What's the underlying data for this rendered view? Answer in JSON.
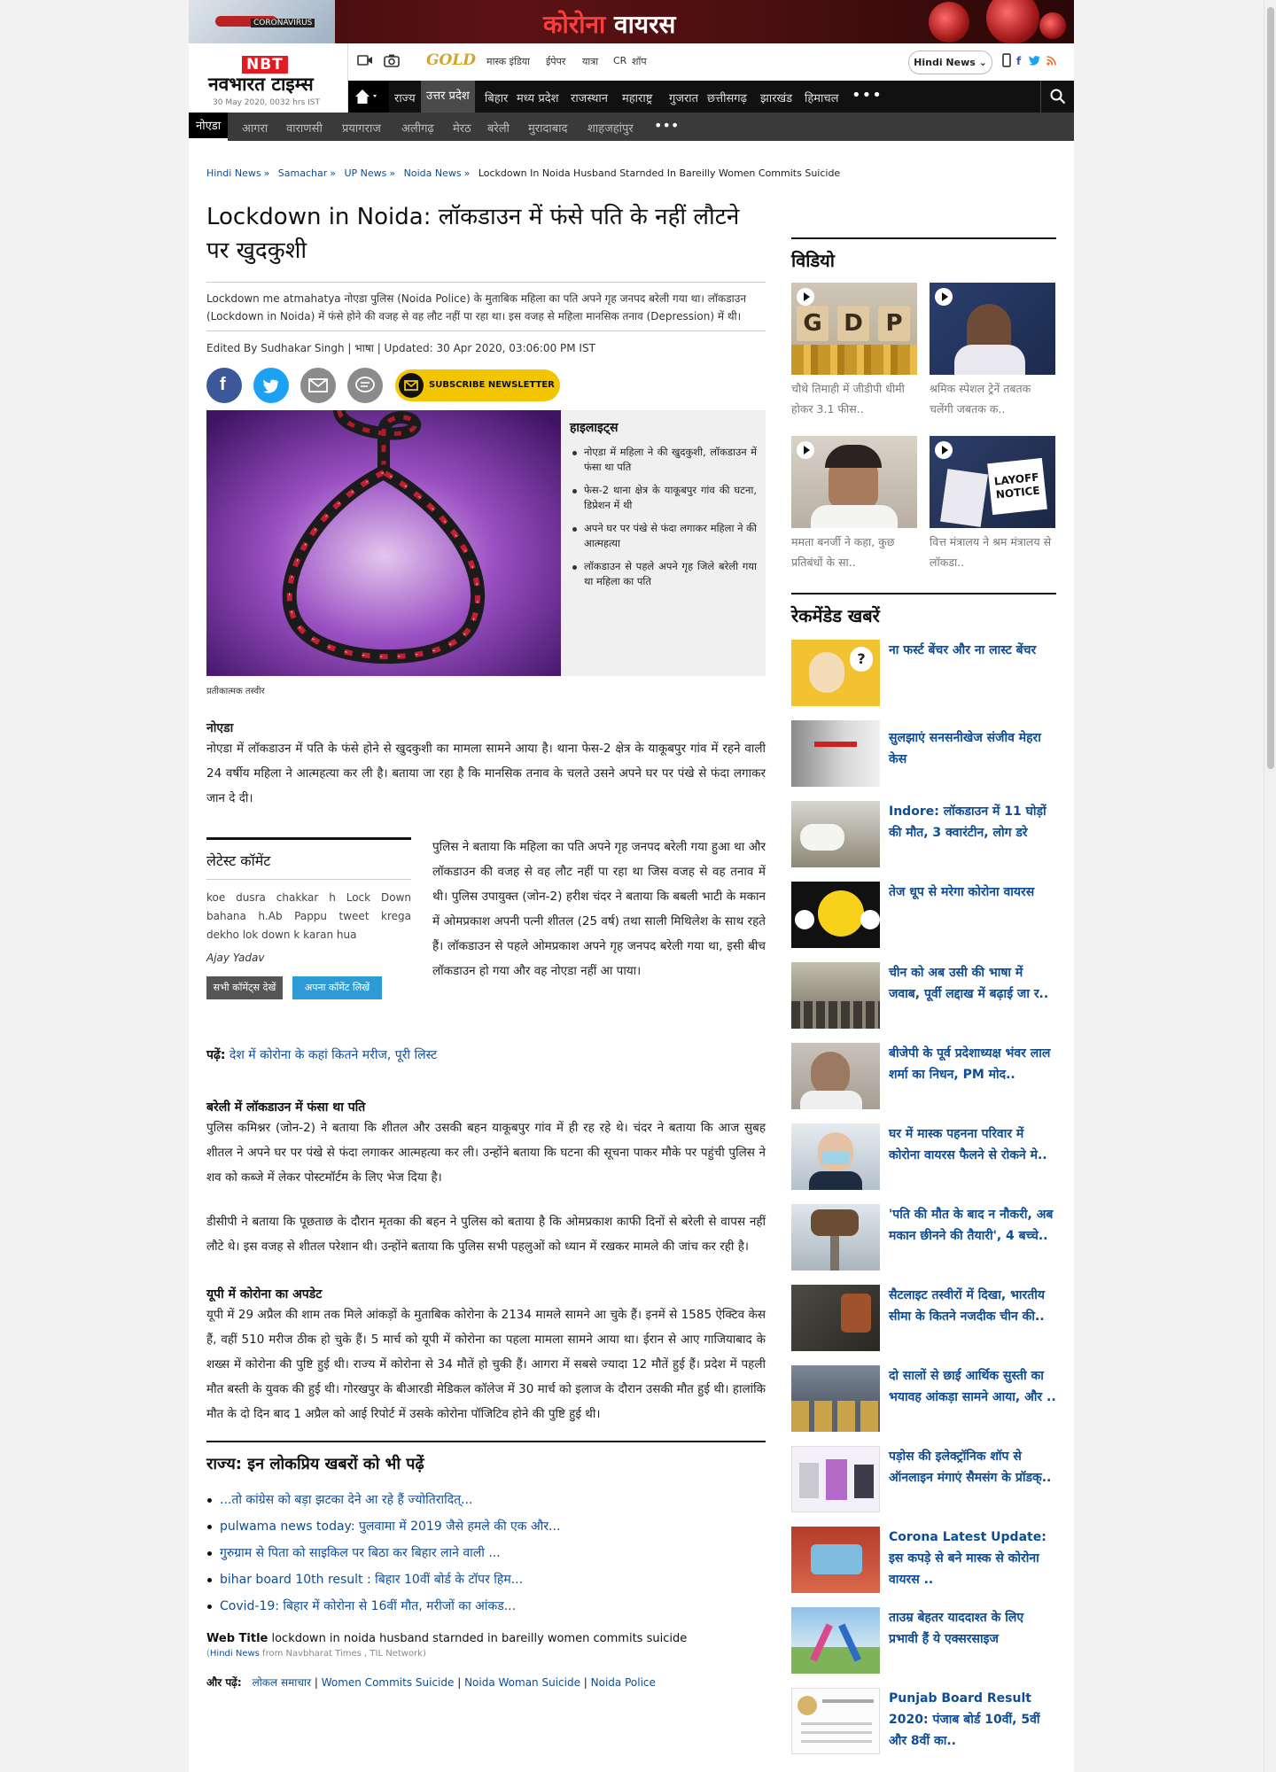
{
  "banner": {
    "title_red": "कोरोना",
    "title_white": "वायरस",
    "tag": "CORONAVIRUS"
  },
  "header": {
    "logo_abbr": "NBT",
    "logo_name": "नवभारत टाइम्स",
    "date": "30 May 2020, 0032 hrs IST",
    "gold": "GOLD",
    "top_links": [
      "मास्क इंडिया",
      "ईपेपर",
      "यात्रा",
      "CR",
      "शॉप"
    ],
    "lang_button": "Hindi News ⌄",
    "social": [
      "f",
      "t",
      "rss"
    ]
  },
  "nav": {
    "items": [
      "राज्य",
      "उत्तर प्रदेश",
      "बिहार",
      "मध्य प्रदेश",
      "राजस्थान",
      "महाराष्ट्र",
      "गुजरात",
      "छत्तीसगढ़",
      "झारखंड",
      "हिमाचल"
    ],
    "more": "•••"
  },
  "subnav": {
    "items": [
      "नोएडा",
      "आगरा",
      "वाराणसी",
      "प्रयागराज",
      "अलीगढ़",
      "मेरठ",
      "बरेली",
      "मुरादाबाद",
      "शाहजहांपुर"
    ],
    "more": "•••"
  },
  "breadcrumb": {
    "items": [
      "Hindi News",
      "Samachar",
      "UP News",
      "Noida News"
    ],
    "sep": "»",
    "current": "Lockdown In Noida Husband Starnded In Bareilly Women Commits Suicide"
  },
  "article": {
    "headline": "Lockdown in Noida: लॉकडाउन में फंसे पति के नहीं लौटने पर खुदकुशी",
    "summary": "Lockdown me atmahatya नोएडा पुलिस (Noida Police) के मुताबिक महिला का पति अपने गृह जनपद बरेली गया था। लॉकडाउन (Lockdown in Noida) में फंसे होने की वजह से वह लौट नहीं पा रहा था। इस वजह से महिला मानसिक तनाव (Depression) में थी।",
    "byline": "Edited By Sudhakar Singh | भाषा | Updated: 30 Apr 2020, 03:06:00 PM IST",
    "newsletter": "SUBSCRIBE NEWSLETTER",
    "highlights_title": "हाइलाइट्स",
    "highlights": [
      "नोएडा में महिला ने की खुदकुशी, लॉकडाउन में फंसा था पति",
      "फेस-2 थाना क्षेत्र के याकूबपुर गांव की घटना, डिप्रेशन में थी",
      "अपने घर पर पंखे से फंदा लगाकर महिला ने की आत्महत्या",
      "लॉकडाउन से पहले अपने गृह जिले बरेली गया था महिला का पति"
    ],
    "caption": "प्रतीकात्मक तस्वीर",
    "place": "नोएडा",
    "para1": "नोएडा में लॉकडाउन में पति के फंसे होने से खुदकुशी का मामला सामने आया है। थाना फेस-2 क्षेत्र के याकूबपुर गांव में रहने वाली 24 वर्षीय महिला ने आत्महत्या कर ली है। बताया जा रहा है कि मानसिक तनाव के चलते उसने अपने घर पर पंखे से फंदा लगाकर जान दे दी।",
    "para2": "पुलिस ने बताया कि महिला का पति अपने गृह जनपद बरेली गया हुआ था और लॉकडाउन की वजह से वह लौट नहीं पा रहा था जिस वजह से वह तनाव में थी। पुलिस उपायुक्त (जोन-2) हरीश चंदर ने बताया कि बबली भाटी के मकान में ओमप्रकाश अपनी पत्नी शीतल (25 वर्ष) तथा साली मिथिलेश के साथ रहते हैं। लॉकडाउन से पहले ओमप्रकाश अपने गृह जनपद बरेली गया था, इसी बीच लॉकडाउन हो गया और वह नोएडा नहीं आ पाया।",
    "read_label": "पढ़ें:",
    "read_link": "देश में कोरोना के कहां कितने मरीज, पूरी लिस्ट",
    "sub1": "बरेली में लॉकडाउन में फंसा था पति",
    "para3": "पुलिस कमिश्नर (जोन-2) ने बताया कि शीतल और उसकी बहन याकूबपुर गांव में ही रह रहे थे। चंदर ने बताया कि आज सुबह शीतल ने अपने घर पर पंखे से फंदा लगाकर आत्महत्या कर ली। उन्होंने बताया कि घटना की सूचना पाकर मौके पर पहुंची पुलिस ने शव को कब्जे में लेकर पोस्टमॉर्टम के लिए भेज दिया है।",
    "para4": "डीसीपी ने बताया कि पूछताछ के दौरान मृतका की बहन ने पुलिस को बताया है कि ओमप्रकाश काफी दिनों से बरेली से वापस नहीं लौटे थे। इस वजह से शीतल परेशान थी। उन्होंने बताया कि पुलिस सभी पहलुओं को ध्यान में रखकर मामले की जांच कर रही है।",
    "sub2": "यूपी में कोरोना का अपडेट",
    "para5": "यूपी में 29 अप्रैल की शाम तक मिले आंकड़ों के मुताबिक कोरोना के 2134 मामले सामने आ चुके हैं। इनमें से 1585 ऐक्टिव केस हैं, वहीं 510 मरीज ठीक हो चुके हैं। 5 मार्च को यूपी में कोरोना का पहला मामला सामने आया था। ईरान से आए गाजियाबाद के शख्स में कोरोना की पुष्टि हुई थी। राज्य में कोरोना से 34 मौतें हो चुकी हैं। आगरा में सबसे ज्यादा 12 मौतें हुई हैं। प्रदेश में पहली मौत बस्ती के युवक की हुई थी। गोरखपुर के बीआरडी मेडिकल कॉलेज में 30 मार्च को इलाज के दौरान उसकी मौत हुई थी। हालांकि मौत के दो दिन बाद 1 अप्रैल को आई रिपोर्ट में उसके कोरोना पॉजिटिव होने की पुष्टि हुई थी।"
  },
  "comments": {
    "title": "लेटेस्ट कॉमेंट",
    "text": "koe dusra chakkar h Lock Down bahana h.Ab Pappu tweet kregа dekho lok down k karan hua",
    "user": "Ajay Yadav",
    "btn_all": "सभी कॉमेंट्स देखें",
    "btn_write": "अपना कॉमेंट लिखें"
  },
  "popular": {
    "title": "राज्य: इन लोकप्रिय खबरों को भी पढ़ें",
    "items": [
      "...तो कांग्रेस को बड़ा झटका देने आ रहे हैं ज्योतिरादित्...",
      "pulwama news today: पुलवामा में 2019 जैसे हमले की एक और...",
      "गुरुग्राम से पिता को साइकिल पर बिठा कर बिहार लाने वाली ...",
      "bihar board 10th result : बिहार 10वीं बोर्ड के टॉपर हिम...",
      "Covid-19: बिहार में कोरोना से 16वीं मौत, मरीजों का आंकड..."
    ]
  },
  "webtitle": {
    "label": "Web Title",
    "text": "lockdown in noida husband starnded in bareilly women commits suicide",
    "src_link": "Hindi News",
    "src_rest": " from Navbharat Times , TIL Network)"
  },
  "bottom": {
    "label": "और पढ़ें:",
    "tags": [
      "लोकल समाचार",
      "Women Commits Suicide",
      "Noida Woman Suicide",
      "Noida Police"
    ]
  },
  "sidebar": {
    "video_title": "विडियो",
    "videos": [
      {
        "caption": "चौथे तिमाही में जीडीपी धीमी होकर 3.1 फीस.."
      },
      {
        "caption": "श्रमिक स्पेशल ट्रेनें तबतक चलेंगी जबतक क.."
      },
      {
        "caption": "ममता बनर्जी ने कहा, कुछ प्रतिबंधों के सा.."
      },
      {
        "caption": "वित्त मंत्रालय ने श्रम मंत्रालय से लॉकडा.."
      }
    ],
    "gdp_letters": [
      "G",
      "D",
      "P"
    ],
    "layoff": "LAYOFF NOTICE",
    "rec_title": "रेकमेंडेड खबरें",
    "recs": [
      "ना फर्स्ट बेंचर और ना लास्ट बेंचर",
      "सुलझाएं सनसनीखेज संजीव मेहरा केस",
      "Indore: लॉकडाउन में 11 घोड़ों की मौत, 3 क्वारंटीन, लोग डरे",
      "तेज धूप से मरेगा कोरोना वायरस",
      "चीन को अब उसी की भाषा में जवाब, पूर्वी लद्दाख में बढ़ाई जा र..",
      "बीजेपी के पूर्व प्रदेशाध्यक्ष भंवर लाल शर्मा का निधन, PM मोद..",
      "घर में मास्क पहनना परिवार में कोरोना वायरस फैलने से रोकने मे..",
      "'पति की मौत के बाद न नौकरी, अब मकान छीनने की तैयारी', 4 बच्चे..",
      "सैटलाइट तस्वीरों में दिखा, भारतीय सीमा के कितने नजदीक चीन की..",
      "दो सालों से छाई आर्थिक सुस्ती का भयावह आंकड़ा सामने आया, और ..",
      "पड़ोस की इलेक्ट्रॉनिक शॉप से ऑनलाइन मंगाएं सैमसंग के प्रॉडक्..",
      "Corona Latest Update: इस कपड़े से बने मास्क से कोरोना वायरस ..",
      "ताउम्र बेहतर याददाश्त के लिए प्रभावी हैं ये एक्सरसाइज",
      "Punjab Board Result 2020: पंजाब बोर्ड 10वीं, 5वीं और 8वीं का.."
    ]
  },
  "colors": {
    "brand_red": "#e21b22",
    "link": "#0e4d95",
    "nav_bg": "#111111",
    "subnav_bg": "#3a3a3a",
    "newsletter": "#f2c500"
  }
}
